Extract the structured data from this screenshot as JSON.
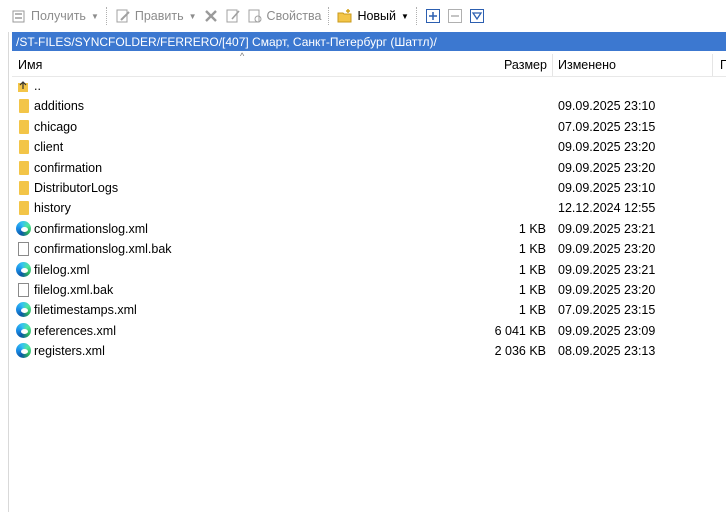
{
  "toolbar": {
    "get_label": "Получить",
    "edit_label": "Править",
    "properties_label": "Свойства",
    "new_label": "Новый"
  },
  "path": "/ST-FILES/SYNCFOLDER/FERRERO/[407] Смарт, Санкт-Петербург (Шаттл)/",
  "columns": {
    "name": "Имя",
    "size": "Размер",
    "modified": "Изменено",
    "extra": "П"
  },
  "rows": [
    {
      "name": "..",
      "type": "parent",
      "size": "",
      "modified": ""
    },
    {
      "name": "additions",
      "type": "folder",
      "size": "",
      "modified": "09.09.2025 23:10"
    },
    {
      "name": "chicago",
      "type": "folder",
      "size": "",
      "modified": "07.09.2025 23:15"
    },
    {
      "name": "client",
      "type": "folder",
      "size": "",
      "modified": "09.09.2025 23:20"
    },
    {
      "name": "confirmation",
      "type": "folder",
      "size": "",
      "modified": "09.09.2025 23:20"
    },
    {
      "name": "DistributorLogs",
      "type": "folder",
      "size": "",
      "modified": "09.09.2025 23:10"
    },
    {
      "name": "history",
      "type": "folder",
      "size": "",
      "modified": "12.12.2024 12:55"
    },
    {
      "name": "confirmationslog.xml",
      "type": "edge",
      "size": "1 KB",
      "modified": "09.09.2025 23:21"
    },
    {
      "name": "confirmationslog.xml.bak",
      "type": "doc",
      "size": "1 KB",
      "modified": "09.09.2025 23:20"
    },
    {
      "name": "filelog.xml",
      "type": "edge",
      "size": "1 KB",
      "modified": "09.09.2025 23:21"
    },
    {
      "name": "filelog.xml.bak",
      "type": "doc",
      "size": "1 KB",
      "modified": "09.09.2025 23:20"
    },
    {
      "name": "filetimestamps.xml",
      "type": "edge",
      "size": "1 KB",
      "modified": "07.09.2025 23:15"
    },
    {
      "name": "references.xml",
      "type": "edge",
      "size": "6 041 KB",
      "modified": "09.09.2025 23:09"
    },
    {
      "name": "registers.xml",
      "type": "edge",
      "size": "2 036 KB",
      "modified": "08.09.2025 23:13"
    }
  ],
  "colors": {
    "pathbar": "#3c78d0",
    "folder": "#f3c548"
  }
}
